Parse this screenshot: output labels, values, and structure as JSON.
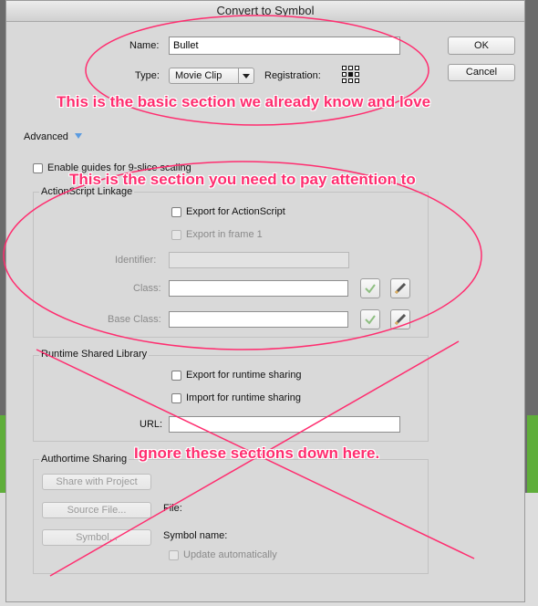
{
  "dialog": {
    "title": "Convert to Symbol",
    "name_label": "Name:",
    "name_value": "Bullet",
    "type_label": "Type:",
    "type_value": "Movie Clip",
    "registration_label": "Registration:",
    "ok_label": "OK",
    "cancel_label": "Cancel",
    "advanced_label": "Advanced",
    "nine_slice_label": "Enable guides for 9-slice scaling"
  },
  "actionscript_linkage": {
    "title": "ActionScript Linkage",
    "export_as_label": "Export for ActionScript",
    "export_frame1_label": "Export in frame 1",
    "identifier_label": "Identifier:",
    "identifier_value": "",
    "class_label": "Class:",
    "class_value": "",
    "base_class_label": "Base Class:",
    "base_class_value": ""
  },
  "runtime_shared_library": {
    "title": "Runtime Shared Library",
    "export_runtime_label": "Export for runtime sharing",
    "import_runtime_label": "Import for runtime sharing",
    "url_label": "URL:",
    "url_value": ""
  },
  "authortime_sharing": {
    "title": "Authortime Sharing",
    "share_project_label": "Share with Project",
    "source_file_label": "Source File...",
    "file_label": "File:",
    "symbol_button_label": "Symbol...",
    "symbol_name_label": "Symbol name:",
    "update_auto_label": "Update automatically"
  },
  "annotations": {
    "basic": "This is the basic section we already know and love",
    "attention": "This is the section you need to pay attention to",
    "ignore": "Ignore these sections down here."
  },
  "colors": {
    "annotation": "#ff2d6f",
    "accent_check": "#5aa84a"
  },
  "icons": [
    "dropdown-arrow-icon",
    "disclosure-triangle-icon",
    "registration-grid-icon",
    "checkmark-icon",
    "pencil-icon"
  ]
}
